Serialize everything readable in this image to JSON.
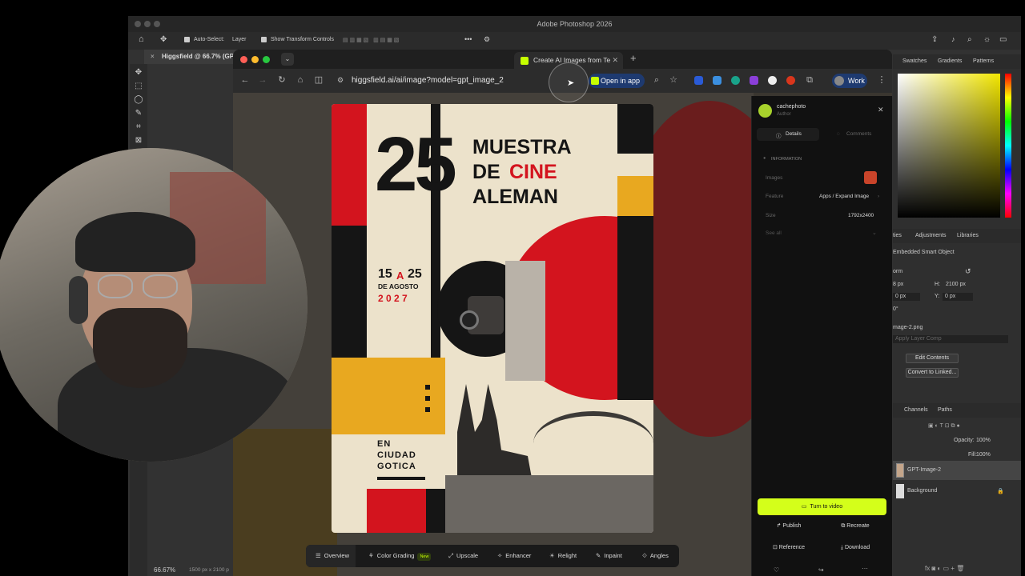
{
  "photoshop": {
    "title": "Adobe Photoshop 2026",
    "options_bar": {
      "auto_select_label": "Auto-Select:",
      "auto_select_value": "Layer",
      "show_transform_label": "Show Transform Controls"
    },
    "doc_tab": "Higgsfield @ 66.7% (GPT",
    "status_zoom": "66.67%",
    "status_size": "1500 px x 2100 p",
    "right_tabs": [
      "Swatches",
      "Gradients",
      "Patterns"
    ],
    "props_tabs": [
      "ties",
      "Adjustments",
      "Libraries"
    ],
    "props": {
      "type": "Embedded Smart Object",
      "transform_label": "orm",
      "w_label": "8 px",
      "h_label": "H:",
      "h_value": "2100 px",
      "x_label": "0 px",
      "y_label": "Y:",
      "y_value": "0 px",
      "angle": "0°",
      "file": "mage-2.png",
      "layer_comp": "Apply Layer Comp",
      "edit_contents": "Edit Contents",
      "convert_linked": "Convert to Linked..."
    },
    "layers_tabs": [
      "Channels",
      "Paths"
    ],
    "opacity_label": "Opacity:",
    "opacity_value": "100%",
    "fill_label": "Fill:",
    "fill_value": "100%",
    "layers": [
      "GPT-Image-2",
      "Background"
    ]
  },
  "browser": {
    "tab_title": "Create AI Images from Te",
    "url": "higgsfield.ai/ai/image?model=gpt_image_2",
    "open_in_app": "Open in app",
    "profile": "Work"
  },
  "poster": {
    "number": "25",
    "line1": "MUESTRA",
    "line2a": "DE",
    "line2b": "CINE",
    "line3": "ALEMAN",
    "date_from": "15",
    "date_a": "A",
    "date_to": "25",
    "date_month": "DE AGOSTO",
    "date_year": "2 0 2 7",
    "city1": "EN",
    "city2": "CIUDAD",
    "city3": "GOTICA"
  },
  "image_tools": [
    {
      "label": "Overview",
      "icon": "overview-icon"
    },
    {
      "label": "Color Grading",
      "icon": "color-grading-icon",
      "badge": "New"
    },
    {
      "label": "Upscale",
      "icon": "upscale-icon"
    },
    {
      "label": "Enhancer",
      "icon": "enhancer-icon"
    },
    {
      "label": "Relight",
      "icon": "relight-icon"
    },
    {
      "label": "Inpaint",
      "icon": "inpaint-icon"
    },
    {
      "label": "Angles",
      "icon": "angles-icon"
    }
  ],
  "detail": {
    "author_name": "cachephoto",
    "author_role": "Author",
    "tab_details": "Details",
    "tab_comments": "Comments",
    "info_header": "INFORMATION",
    "images_label": "Images",
    "feature_label": "Feature",
    "feature_path": "Apps / Expand Image",
    "size_label": "Size",
    "size_value": "1792x2400",
    "see_all": "See all",
    "turn_to_video": "Turn to video",
    "publish": "Publish",
    "recreate": "Recreate",
    "reference": "Reference",
    "download": "Download"
  },
  "colors": {
    "accent_lime": "#d4ff1a",
    "poster_red": "#d3141e",
    "poster_yellow": "#e8a820",
    "poster_black": "#151515",
    "poster_cream": "#ece2cb"
  }
}
